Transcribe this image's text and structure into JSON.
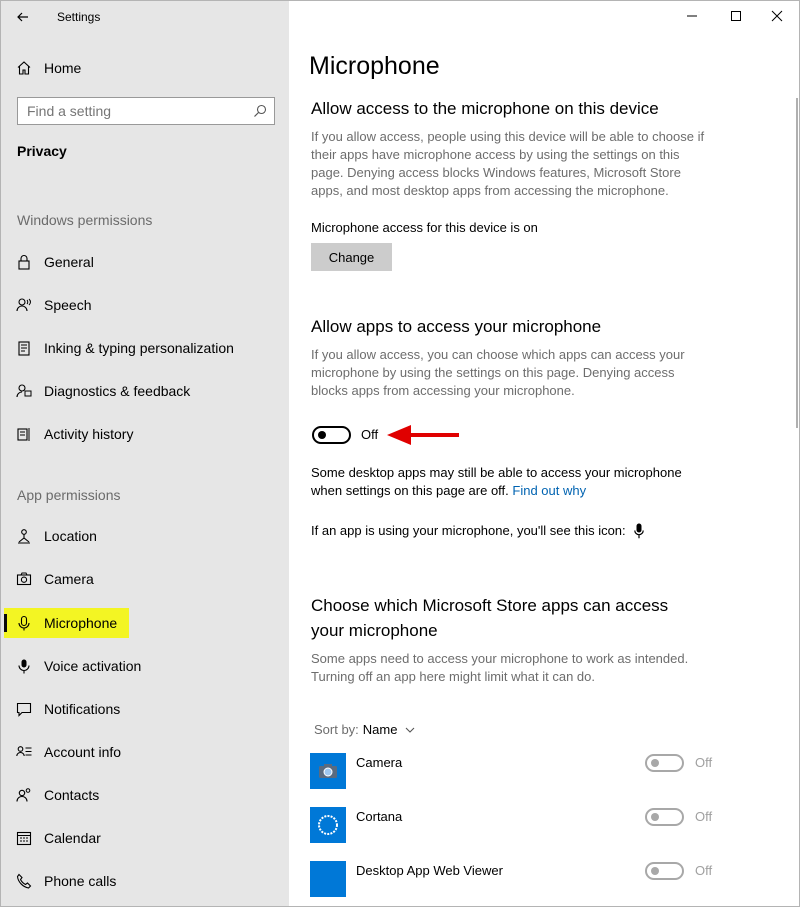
{
  "window": {
    "title": "Settings",
    "controls": {
      "minimize": "—",
      "maximize": "☐",
      "close": "✕"
    }
  },
  "sidebar": {
    "home_label": "Home",
    "search_placeholder": "Find a setting",
    "current_section": "Privacy",
    "windows_permissions_header": "Windows permissions",
    "windows_permissions": [
      {
        "label": "General",
        "icon": "lock-icon"
      },
      {
        "label": "Speech",
        "icon": "speech-icon"
      },
      {
        "label": "Inking & typing personalization",
        "icon": "inking-icon"
      },
      {
        "label": "Diagnostics & feedback",
        "icon": "diagnostics-icon"
      },
      {
        "label": "Activity history",
        "icon": "activity-icon"
      }
    ],
    "app_permissions_header": "App permissions",
    "app_permissions": [
      {
        "label": "Location",
        "icon": "location-icon"
      },
      {
        "label": "Camera",
        "icon": "camera-icon"
      },
      {
        "label": "Microphone",
        "icon": "microphone-icon",
        "selected": true
      },
      {
        "label": "Voice activation",
        "icon": "voice-activation-icon"
      },
      {
        "label": "Notifications",
        "icon": "notifications-icon"
      },
      {
        "label": "Account info",
        "icon": "account-info-icon"
      },
      {
        "label": "Contacts",
        "icon": "contacts-icon"
      },
      {
        "label": "Calendar",
        "icon": "calendar-icon"
      },
      {
        "label": "Phone calls",
        "icon": "phone-icon"
      }
    ],
    "highlight_color": "#f3f523"
  },
  "main": {
    "page_title": "Microphone",
    "device_section": {
      "heading": "Allow access to the microphone on this device",
      "description": "If you allow access, people using this device will be able to choose if their apps have microphone access by using the settings on this page. Denying access blocks Windows features, Microsoft Store apps, and most desktop apps from accessing the microphone.",
      "status": "Microphone access for this device is on",
      "change_button": "Change"
    },
    "apps_section": {
      "heading": "Allow apps to access your microphone",
      "description": "If you allow access, you can choose which apps can access your microphone by using the settings on this page. Denying access blocks apps from accessing your microphone.",
      "toggle_state": "Off",
      "note_line1": "Some desktop apps may still be able to access your microphone",
      "note_line2": "when settings on this page are off.",
      "note_link": "Find out why",
      "icon_note": "If an app is using your microphone, you'll see this icon:"
    },
    "store_section": {
      "heading_line1": "Choose which Microsoft Store apps can access",
      "heading_line2": "your microphone",
      "description": "Some apps need to access your microphone to work as intended. Turning off an app here might limit what it can do.",
      "sort_label": "Sort by:",
      "sort_value": "Name",
      "apps": [
        {
          "name": "Camera",
          "state": "Off",
          "icon": "camera-app-icon"
        },
        {
          "name": "Cortana",
          "state": "Off",
          "icon": "cortana-app-icon"
        },
        {
          "name": "Desktop App Web Viewer",
          "state": "Off",
          "icon": "web-viewer-app-icon"
        }
      ]
    },
    "accent_color": "#0078d7",
    "link_color": "#0063b1",
    "arrow_color": "#e00000"
  }
}
